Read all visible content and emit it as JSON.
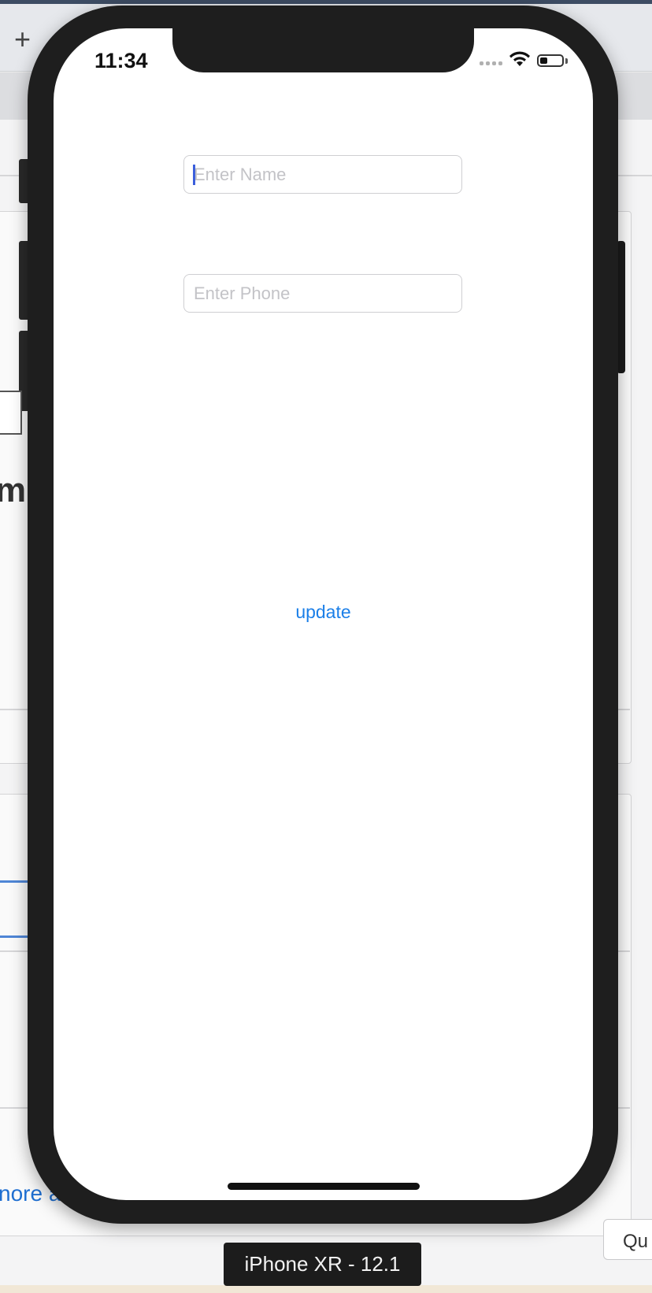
{
  "background": {
    "tab_plus_icon": "plus-icon",
    "visible_text_fragment": "m",
    "link_fragment": "nore a",
    "button_fragment": "Qu"
  },
  "status_bar": {
    "time": "11:34",
    "icons": [
      "cellular-signal-icon",
      "wifi-icon",
      "battery-icon"
    ],
    "battery_level": 0.35
  },
  "form": {
    "name_placeholder": "Enter Name",
    "phone_placeholder": "Enter Phone",
    "update_label": "update"
  },
  "simulator": {
    "device_label": "iPhone XR - 12.1"
  },
  "colors": {
    "accent": "#1b7fe8",
    "caret": "#3b5fdc",
    "frame": "#1e1e1e"
  }
}
